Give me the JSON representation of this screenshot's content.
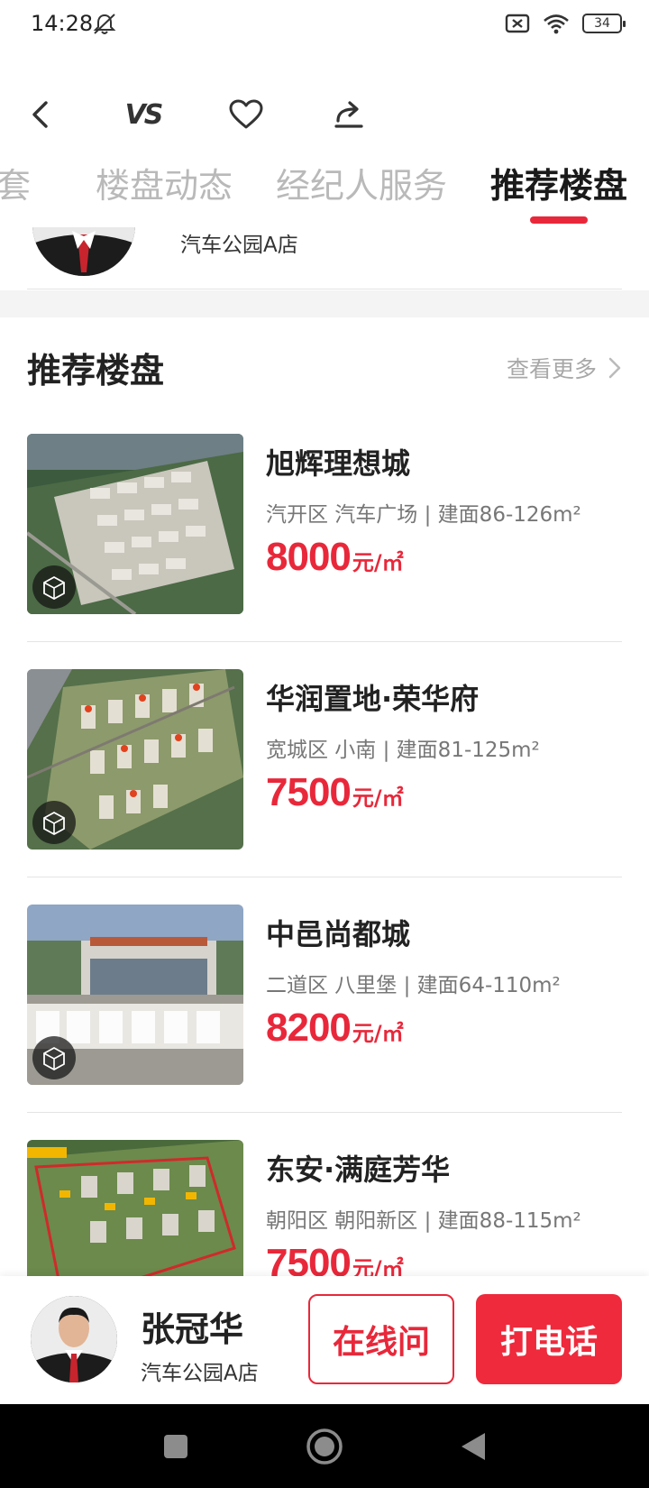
{
  "status_bar": {
    "time": "14:28",
    "battery": "34"
  },
  "toolbar": {
    "vs_label": "VS"
  },
  "tabs": [
    {
      "label": "配套",
      "active": false
    },
    {
      "label": "楼盘动态",
      "active": false
    },
    {
      "label": "经纪人服务",
      "active": false
    },
    {
      "label": "推荐楼盘",
      "active": true
    }
  ],
  "agent_snippet": {
    "store": "汽车公园A店"
  },
  "section": {
    "title": "推荐楼盘",
    "see_more": "查看更多"
  },
  "listings": [
    {
      "name": "旭辉理想城",
      "meta": "汽开区 汽车广场 | 建面86-126m²",
      "price": "8000",
      "unit": "元/㎡"
    },
    {
      "name": "华润置地·荣华府",
      "meta": "宽城区 小南 | 建面81-125m²",
      "price": "7500",
      "unit": "元/㎡"
    },
    {
      "name": "中邑尚都城",
      "meta": "二道区 八里堡 | 建面64-110m²",
      "price": "8200",
      "unit": "元/㎡"
    },
    {
      "name": "东安·满庭芳华",
      "meta": "朝阳区 朝阳新区 | 建面88-115m²",
      "price": "7500",
      "unit": "元/㎡"
    }
  ],
  "bottom_bar": {
    "agent_name": "张冠华",
    "store": "汽车公园A店",
    "online_label": "在线问",
    "call_label": "打电话"
  },
  "colors": {
    "accent": "#e8283a",
    "muted": "#b9b9b9"
  }
}
